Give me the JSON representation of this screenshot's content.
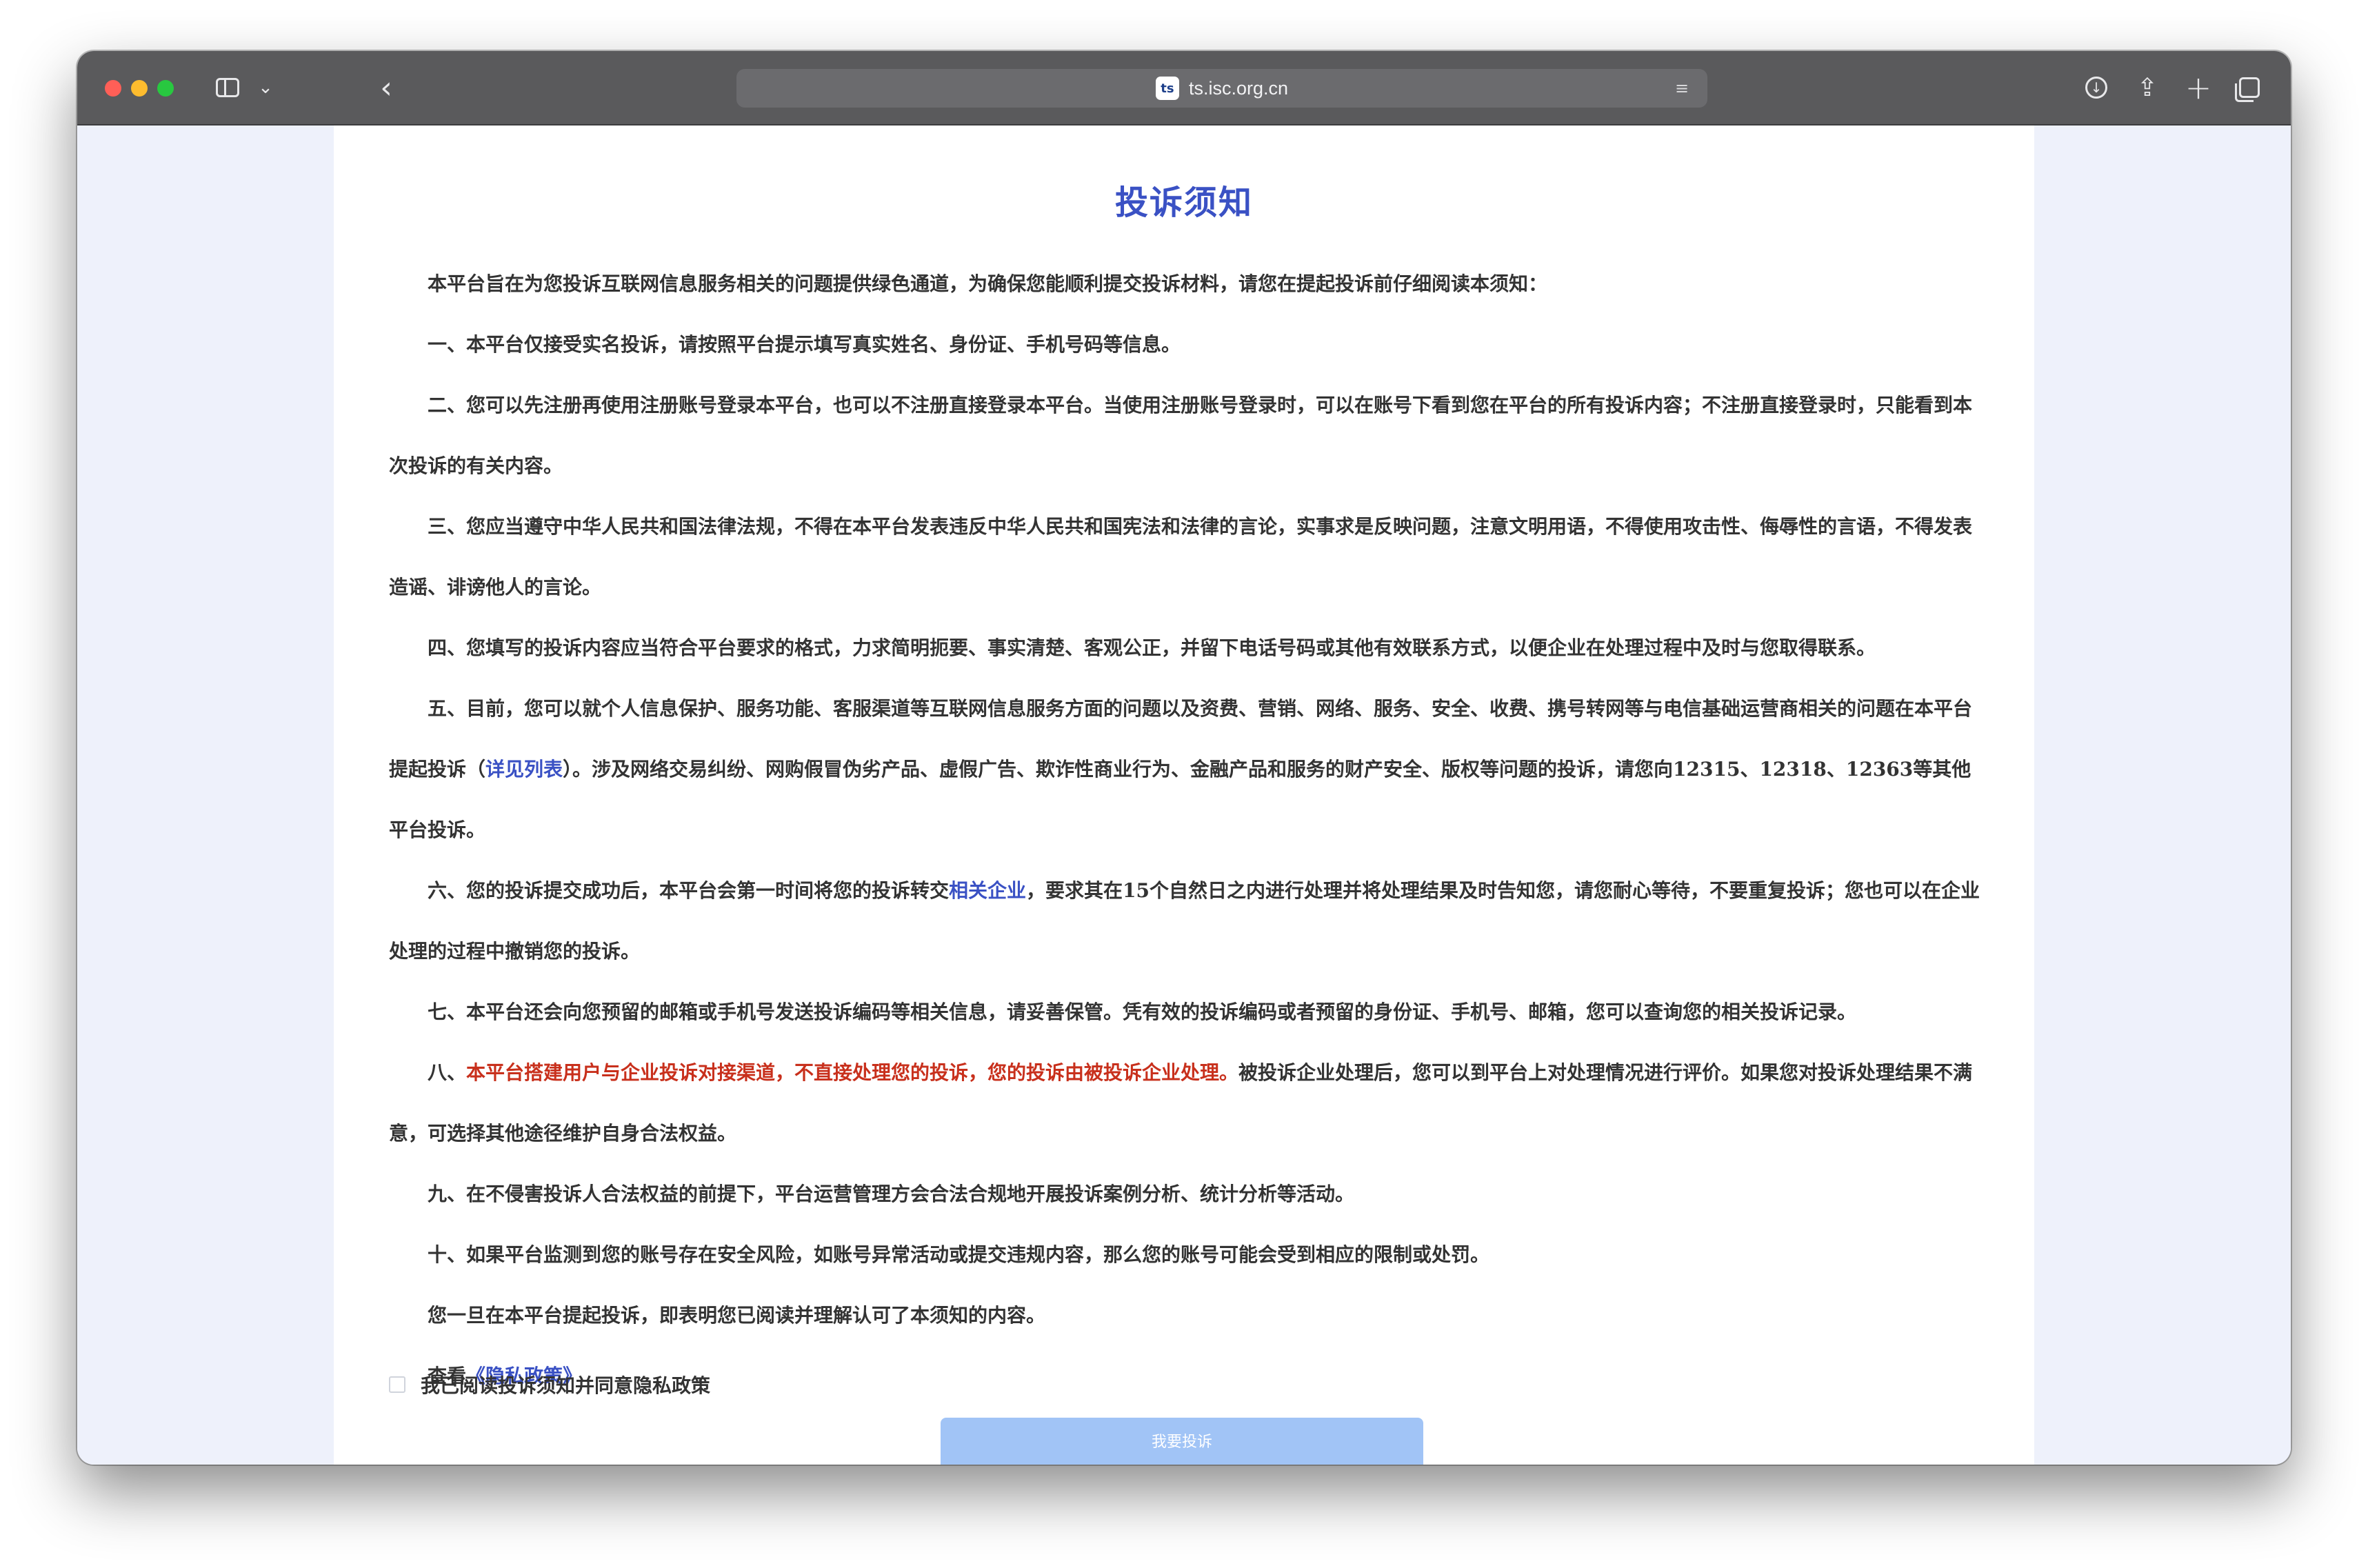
{
  "browser": {
    "url": "ts.isc.org.cn",
    "site_badge": "ts",
    "icons": {
      "sidebar": "sidebar-icon",
      "tab_menu": "chevron-down-icon",
      "back": "back-arrow-icon",
      "reader": "reader-mode-icon",
      "download": "download-icon",
      "share": "share-icon",
      "new_tab": "plus-icon",
      "tab_overview": "tabs-icon"
    }
  },
  "page": {
    "title": "投诉须知",
    "intro": "本平台旨在为您投诉互联网信息服务相关的问题提供绿色通道，为确保您能顺利提交投诉材料，请您在提起投诉前仔细阅读本须知：",
    "item1": "一、本平台仅接受实名投诉，请按照平台提示填写真实姓名、身份证、手机号码等信息。",
    "item2": "二、您可以先注册再使用注册账号登录本平台，也可以不注册直接登录本平台。当使用注册账号登录时，可以在账号下看到您在平台的所有投诉内容；不注册直接登录时，只能看到本次投诉的有关内容。",
    "item3": "三、您应当遵守中华人民共和国法律法规，不得在本平台发表违反中华人民共和国宪法和法律的言论，实事求是反映问题，注意文明用语，不得使用攻击性、侮辱性的言语，不得发表造谣、诽谤他人的言论。",
    "item4": "四、您填写的投诉内容应当符合平台要求的格式，力求简明扼要、事实清楚、客观公正，并留下电话号码或其他有效联系方式，以便企业在处理过程中及时与您取得联系。",
    "item5_a": "五、目前，您可以就个人信息保护、服务功能、客服渠道等互联网信息服务方面的问题以及资费、营销、网络、服务、安全、收费、携号转网等与电信基础运营商相关的问题在本平台提起投诉（",
    "item5_link": "详见列表",
    "item5_b": "）。涉及网络交易纠纷、网购假冒伪劣产品、虚假广告、欺诈性商业行为、金融产品和服务的财产安全、版权等问题的投诉，请您向12315、12318、12363等其他平台投诉。",
    "item6_a": "六、您的投诉提交成功后，本平台会第一时间将您的投诉转交",
    "item6_link": "相关企业",
    "item6_b": "，要求其在15个自然日之内进行处理并将处理结果及时告知您，请您耐心等待，不要重复投诉；您也可以在企业处理的过程中撤销您的投诉。",
    "item7": "七、本平台还会向您预留的邮箱或手机号发送投诉编码等相关信息，请妥善保管。凭有效的投诉编码或者预留的身份证、手机号、邮箱，您可以查询您的相关投诉记录。",
    "item8_a": "八、",
    "item8_warn": "本平台搭建用户与企业投诉对接渠道，不直接处理您的投诉，您的投诉由被投诉企业处理。",
    "item8_b": "被投诉企业处理后，您可以到平台上对处理情况进行评价。如果您对投诉处理结果不满意，可选择其他途径维护自身合法权益。",
    "item9": "九、在不侵害投诉人合法权益的前提下，平台运营管理方会合法合规地开展投诉案例分析、统计分析等活动。",
    "item10": "十、如果平台监测到您的账号存在安全风险，如账号异常活动或提交违规内容，那么您的账号可能会受到相应的限制或处罚。",
    "closing": "您一旦在本平台提起投诉，即表明您已阅读并理解认可了本须知的内容。",
    "privacy_prefix": "查看",
    "privacy_link": "《隐私政策》",
    "agree_label": "我已阅读投诉须知并同意隐私政策",
    "agree_checked": false,
    "submit_label": "我要投诉"
  },
  "colors": {
    "title": "#3a51c4",
    "link": "#3a51c4",
    "warning": "#c8301c",
    "submit_disabled": "#a1c4f6"
  }
}
